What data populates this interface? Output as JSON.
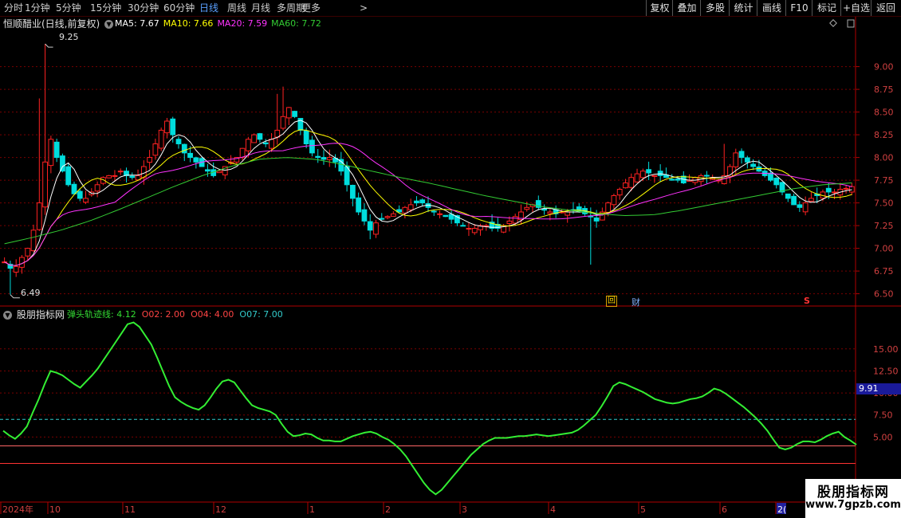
{
  "toolbar": {
    "periods": [
      "分时",
      "1分钟",
      "5分钟",
      "15分钟",
      "30分钟",
      "60分钟",
      "日线",
      "周线",
      "月线",
      "多周期",
      "更多"
    ],
    "active_period": "日线",
    "more_arrow": ">",
    "right_buttons": [
      "复权",
      "叠加",
      "多股",
      "统计",
      "画线",
      "F10",
      "标记",
      "+自选",
      "返回"
    ]
  },
  "main_panel": {
    "stock_title": "恒顺醋业(日线,前复权)",
    "ma": [
      {
        "label": "MA5: 7.67",
        "color": "#ffffff"
      },
      {
        "label": "MA10: 7.66",
        "color": "#ffff00"
      },
      {
        "label": "MA20: 7.59",
        "color": "#ff33ff"
      },
      {
        "label": "MA60: 7.72",
        "color": "#33cc33"
      }
    ],
    "max_label": "9.25",
    "min_label": "6.49",
    "markers": {
      "fuquan": "回",
      "cai": "财",
      "s": "S"
    }
  },
  "sub_panel": {
    "title": "股朋指标网",
    "legend": [
      {
        "label": "弹头轨迹线: 4.12",
        "color": "#33dd33"
      },
      {
        "label": "O02: 2.00",
        "color": "#ff4444"
      },
      {
        "label": "O04: 4.00",
        "color": "#ff4444"
      },
      {
        "label": "O07: 7.00",
        "color": "#33cccc"
      }
    ],
    "current_value": "9.91"
  },
  "x_axis": {
    "labels": [
      "2024年",
      "10",
      "11",
      "12",
      "1",
      "2",
      "3",
      "4",
      "5",
      "6",
      "2("
    ]
  },
  "watermark": {
    "line1": "股朋指标网",
    "line2": "www.7gpzb.com"
  },
  "chart_data": {
    "type": "candlestick",
    "price_axis": {
      "ticks": [
        6.5,
        6.75,
        7.0,
        7.25,
        7.5,
        7.75,
        8.0,
        8.25,
        8.5,
        8.75,
        9.0
      ],
      "tick_labels": [
        "6.50",
        "6.75",
        "7.00",
        "7.25",
        "7.50",
        "7.75",
        "8.00",
        "8.25",
        "8.50",
        "8.75",
        "9.00"
      ],
      "range": [
        6.4,
        9.4
      ]
    },
    "indicator_axis": {
      "ticks": [
        5.0,
        7.5,
        10.0,
        12.5,
        15.0
      ],
      "tick_labels": [
        "5.00",
        "7.50",
        "10.00",
        "12.50",
        "15.00"
      ],
      "range": [
        -2.2,
        18.6
      ]
    },
    "closes": [
      6.85,
      6.78,
      6.8,
      6.9,
      7.0,
      7.2,
      7.5,
      7.95,
      8.2,
      8.0,
      7.85,
      7.7,
      7.6,
      7.55,
      7.55,
      7.62,
      7.7,
      7.78,
      7.8,
      7.8,
      7.85,
      7.8,
      7.78,
      7.8,
      7.9,
      8.0,
      8.15,
      8.3,
      8.4,
      8.25,
      8.15,
      8.05,
      8.0,
      7.95,
      7.9,
      7.85,
      7.8,
      7.85,
      7.9,
      7.95,
      8.0,
      8.1,
      8.2,
      8.25,
      8.2,
      8.15,
      8.2,
      8.3,
      8.45,
      8.55,
      8.45,
      8.3,
      8.15,
      8.05,
      8.0,
      7.98,
      8.0,
      7.95,
      7.85,
      7.7,
      7.55,
      7.4,
      7.3,
      7.2,
      7.28,
      7.32,
      7.35,
      7.38,
      7.4,
      7.45,
      7.48,
      7.5,
      7.5,
      7.45,
      7.4,
      7.38,
      7.35,
      7.32,
      7.28,
      7.25,
      7.22,
      7.22,
      7.25,
      7.25,
      7.22,
      7.22,
      7.25,
      7.3,
      7.35,
      7.4,
      7.45,
      7.48,
      7.45,
      7.42,
      7.4,
      7.38,
      7.4,
      7.4,
      7.42,
      7.4,
      7.38,
      7.35,
      7.3,
      7.4,
      7.5,
      7.58,
      7.65,
      7.72,
      7.78,
      7.82,
      7.85,
      7.83,
      7.8,
      7.8,
      7.78,
      7.75,
      7.75,
      7.72,
      7.75,
      7.78,
      7.8,
      7.8,
      7.78,
      7.75,
      7.8,
      7.9,
      8.05,
      8.0,
      7.95,
      7.9,
      7.85,
      7.8,
      7.75,
      7.7,
      7.62,
      7.55,
      7.48,
      7.45,
      7.5,
      7.55,
      7.58,
      7.62,
      7.62,
      7.62,
      7.65,
      7.66,
      7.68
    ],
    "indicator": {
      "name": "弹头轨迹线",
      "last": 4.12,
      "reference_lines": [
        2.0,
        4.0,
        7.0
      ],
      "values": [
        5.7,
        5.2,
        4.8,
        5.4,
        6.2,
        7.8,
        9.3,
        11.0,
        12.5,
        12.3,
        12.0,
        11.5,
        11.0,
        10.6,
        11.3,
        12.0,
        12.8,
        13.8,
        14.8,
        15.8,
        16.8,
        17.8,
        18.0,
        17.5,
        16.5,
        15.5,
        14.0,
        12.4,
        10.8,
        9.5,
        9.0,
        8.6,
        8.3,
        8.1,
        8.6,
        9.5,
        10.5,
        11.3,
        11.5,
        11.2,
        10.3,
        9.4,
        8.6,
        8.3,
        8.1,
        7.9,
        7.5,
        6.5,
        5.6,
        5.1,
        5.2,
        5.4,
        5.3,
        4.9,
        4.6,
        4.6,
        4.5,
        4.5,
        4.8,
        5.1,
        5.3,
        5.5,
        5.6,
        5.4,
        5.0,
        4.7,
        4.2,
        3.6,
        2.8,
        1.8,
        0.8,
        -0.2,
        -1.0,
        -1.5,
        -1.0,
        -0.2,
        0.6,
        1.4,
        2.2,
        3.0,
        3.6,
        4.2,
        4.6,
        4.9,
        4.9,
        4.9,
        5.0,
        5.1,
        5.1,
        5.2,
        5.3,
        5.2,
        5.1,
        5.2,
        5.3,
        5.4,
        5.5,
        5.8,
        6.3,
        6.9,
        7.5,
        8.5,
        9.6,
        10.8,
        11.2,
        11.0,
        10.7,
        10.4,
        10.1,
        9.7,
        9.3,
        9.1,
        8.9,
        8.8,
        8.9,
        9.1,
        9.3,
        9.4,
        9.6,
        10.0,
        10.5,
        10.3,
        9.9,
        9.4,
        8.9,
        8.4,
        7.8,
        7.2,
        6.5,
        5.7,
        4.7,
        3.8,
        3.6,
        3.8,
        4.2,
        4.5,
        4.5,
        4.4,
        4.7,
        5.1,
        5.4,
        5.6,
        5.0,
        4.6,
        4.12
      ]
    }
  }
}
